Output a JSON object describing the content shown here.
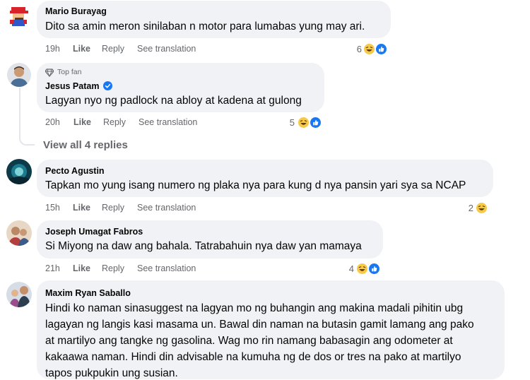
{
  "comments": [
    {
      "author": "Mario Burayag",
      "text": "Dito sa amin meron sinilaban n motor para lumabas yung may ari.",
      "time": "19h",
      "like": "Like",
      "reply": "Reply",
      "translate": "See translation",
      "reaction_count": "6",
      "reactions": [
        "haha",
        "like"
      ]
    },
    {
      "badge": "Top fan",
      "author": "Jesus Patam",
      "verified": true,
      "text": "Lagyan nyo ng padlock na abloy at kadena at gulong",
      "time": "20h",
      "like": "Like",
      "reply": "Reply",
      "translate": "See translation",
      "reaction_count": "5",
      "reactions": [
        "haha",
        "like"
      ]
    },
    {
      "author": "Pecto Agustin",
      "text": "Tapkan mo yung isang numero ng plaka nya para kung d nya pansin yari sya sa NCAP",
      "time": "15h",
      "like": "Like",
      "reply": "Reply",
      "translate": "See translation",
      "reaction_count": "2",
      "reactions": [
        "haha"
      ]
    },
    {
      "author": "Joseph Umagat Fabros",
      "text": "Si Miyong na daw ang bahala. Tatrabahuin nya daw yan mamaya",
      "time": "21h",
      "like": "Like",
      "reply": "Reply",
      "translate": "See translation",
      "reaction_count": "4",
      "reactions": [
        "haha",
        "like"
      ]
    },
    {
      "author": "Maxim Ryan Saballo",
      "text_lines": [
        "Hindi ko naman sinasuggest na lagyan mo ng buhangin ang makina madali pihitin ubg",
        "lagayan ng langis kasi masama un. Bawal din naman na butasin gamit lamang ang pako",
        "at martilyo ang tangke ng gasolina. Wag mo rin namang babasagin ang odometer at",
        "kakaawa naman. Hindi din advisable na kumuha ng de dos or tres na pako at martilyo",
        "tapos pukpukin ung susian."
      ]
    }
  ],
  "view_replies": "View all 4 replies",
  "colors": {
    "bubble": "#f0f2f5",
    "meta": "#65676b",
    "like_blue": "#1877f2",
    "haha_yellow": "#f7c948"
  }
}
